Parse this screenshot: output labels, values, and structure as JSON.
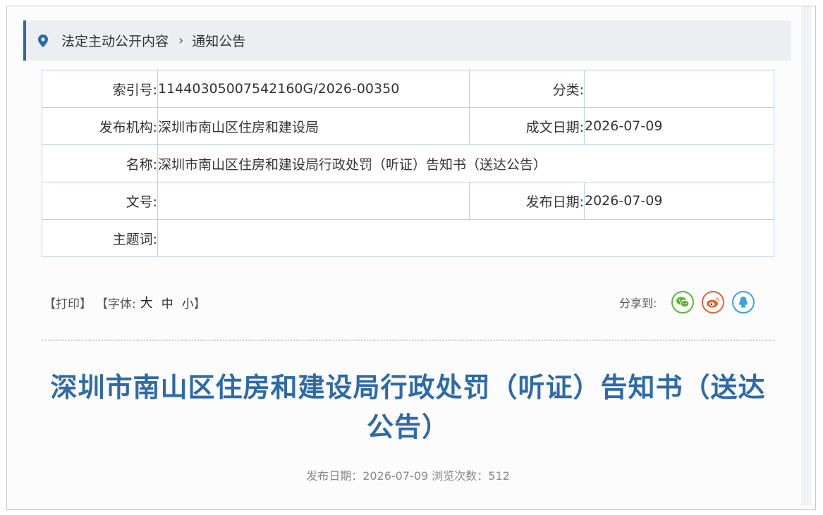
{
  "breadcrumb": {
    "items": [
      "法定主动公开内容",
      "通知公告"
    ],
    "separator": "›"
  },
  "info": {
    "index_label": "索引号:",
    "index_value": "11440305007542160G/2026-00350",
    "category_label": "分类:",
    "category_value": "",
    "publisher_label": "发布机构:",
    "publisher_value": "深圳市南山区住房和建设局",
    "written_date_label": "成文日期:",
    "written_date_value": "2026-07-09",
    "name_label": "名称:",
    "name_value": "深圳市南山区住房和建设局行政处罚（听证）告知书（送达公告）",
    "doc_no_label": "文号:",
    "doc_no_value": "",
    "publish_date_label": "发布日期:",
    "publish_date_value": "2026-07-09",
    "keywords_label": "主题词:",
    "keywords_value": ""
  },
  "toolbar": {
    "print": "【打印】",
    "font_open": "【字体:",
    "font_large": "大",
    "font_medium": "中",
    "font_small": "小",
    "font_close": "】"
  },
  "share": {
    "label": "分享到:",
    "icons": [
      "wechat-icon",
      "weibo-icon",
      "qq-icon"
    ],
    "colors": {
      "wechat": "#5bb53b",
      "weibo": "#e8613c",
      "qq": "#3aa3e3"
    }
  },
  "article": {
    "title": "深圳市南山区住房和建设局行政处罚（听证）告知书（送达公告）",
    "meta": "发布日期：2026-07-09 浏览次数：512"
  },
  "colors": {
    "accent": "#2d6aa9",
    "border": "#b9d3e6"
  }
}
